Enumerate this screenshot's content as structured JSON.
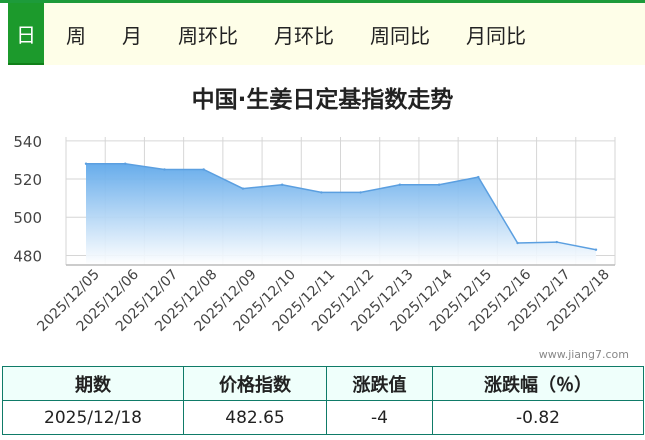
{
  "tabs": [
    {
      "label": "日",
      "active": true
    },
    {
      "label": "周",
      "active": false
    },
    {
      "label": "月",
      "active": false
    },
    {
      "label": "周环比",
      "active": false
    },
    {
      "label": "月环比",
      "active": false
    },
    {
      "label": "周同比",
      "active": false
    },
    {
      "label": "月同比",
      "active": false
    }
  ],
  "watermark": "www.jiang7.com",
  "colors": {
    "accent": "#1c9a2c",
    "fill_top": "#5fa8ea",
    "line": "#5b9fe0",
    "table_border": "#0f7b68"
  },
  "chart_data": {
    "type": "area",
    "title": "中国·生姜日定基指数走势",
    "xlabel": "",
    "ylabel": "",
    "x": [
      "2025/12/05",
      "2025/12/06",
      "2025/12/07",
      "2025/12/08",
      "2025/12/09",
      "2025/12/10",
      "2025/12/11",
      "2025/12/12",
      "2025/12/13",
      "2025/12/14",
      "2025/12/15",
      "2025/12/16",
      "2025/12/17",
      "2025/12/18"
    ],
    "series": [
      {
        "values": [
          528,
          528,
          525,
          525,
          515,
          517,
          513,
          513,
          517,
          517,
          521,
          486.5,
          487,
          483
        ]
      }
    ],
    "ylim": [
      475,
      542
    ],
    "yticks": [
      480,
      500,
      520,
      540
    ],
    "grid": true
  },
  "table": {
    "headers": [
      "期数",
      "价格指数",
      "涨跌值",
      "涨跌幅（％）"
    ],
    "row": [
      "2025/12/18",
      "482.65",
      "-4",
      "-0.82"
    ]
  }
}
